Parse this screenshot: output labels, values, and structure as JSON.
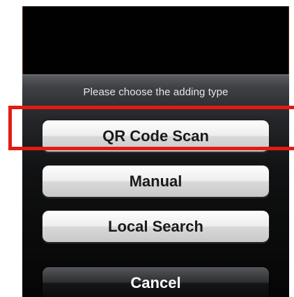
{
  "action_sheet": {
    "title": "Please choose the adding type",
    "buttons": [
      {
        "label": "QR Code Scan",
        "style": "light"
      },
      {
        "label": "Manual",
        "style": "light"
      },
      {
        "label": "Local Search",
        "style": "light"
      },
      {
        "label": "Cancel",
        "style": "dark"
      }
    ]
  },
  "annotation": {
    "highlight_target": "QR Code Scan",
    "color": "#e31b12"
  }
}
